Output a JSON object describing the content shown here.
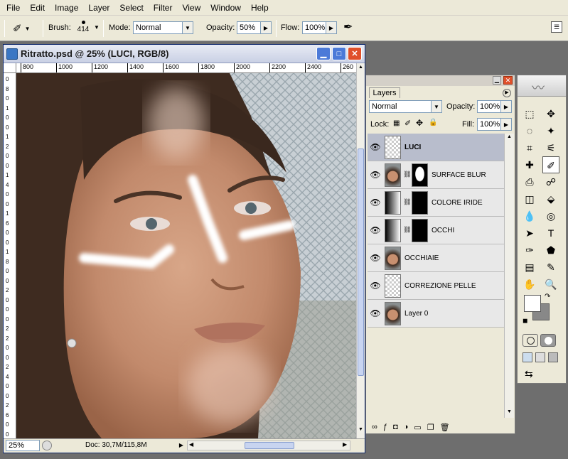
{
  "menu": [
    "File",
    "Edit",
    "Image",
    "Layer",
    "Select",
    "Filter",
    "View",
    "Window",
    "Help"
  ],
  "options": {
    "brush_label": "Brush:",
    "brush_size": "414",
    "mode_label": "Mode:",
    "mode_value": "Normal",
    "opacity_label": "Opacity:",
    "opacity_value": "50%",
    "flow_label": "Flow:",
    "flow_value": "100%"
  },
  "document": {
    "title": "Ritratto.psd @ 25% (LUCI, RGB/8)",
    "ruler_top": [
      "800",
      "1000",
      "1200",
      "1400",
      "1600",
      "1800",
      "2000",
      "2200",
      "2400",
      "260"
    ],
    "ruler_left": [
      "0",
      "8",
      "0",
      "1",
      "0",
      "0",
      "1",
      "2",
      "0",
      "0",
      "1",
      "4",
      "0",
      "0",
      "1",
      "6",
      "0",
      "0",
      "1",
      "8",
      "0",
      "0",
      "2",
      "0",
      "0",
      "0",
      "2",
      "2",
      "0",
      "0",
      "2",
      "4",
      "0",
      "0",
      "2",
      "6",
      "0",
      "0"
    ],
    "zoom": "25%",
    "doc_info": "Doc: 30,7M/115,8M"
  },
  "layers": {
    "tab": "Layers",
    "blend_mode": "Normal",
    "opacity_label": "Opacity:",
    "opacity_value": "100%",
    "lock_label": "Lock:",
    "fill_label": "Fill:",
    "fill_value": "100%",
    "items": [
      {
        "name": "LUCI",
        "selected": true,
        "thumb": "transparent",
        "mask": null
      },
      {
        "name": "SURFACE BLUR",
        "selected": false,
        "thumb": "photo",
        "mask": "silhouette"
      },
      {
        "name": "COLORE IRIDE",
        "selected": false,
        "thumb": "levels",
        "mask": "black"
      },
      {
        "name": "OCCHI",
        "selected": false,
        "thumb": "levels",
        "mask": "black"
      },
      {
        "name": "OCCHIAIE",
        "selected": false,
        "thumb": "photo",
        "mask": null
      },
      {
        "name": "CORREZIONE PELLE",
        "selected": false,
        "thumb": "transparent",
        "mask": null
      },
      {
        "name": "Layer 0",
        "selected": false,
        "thumb": "photo",
        "mask": null
      }
    ]
  },
  "tools": {
    "glyphs": [
      "⬚",
      "✥",
      "◌",
      "✦",
      "⌗",
      "✎",
      "✒",
      "⚘",
      "⬓",
      "◈",
      "💧",
      "◉",
      "➤",
      "T",
      "✑",
      "✪",
      "▤",
      "✐",
      "✋",
      "🔍"
    ],
    "tool_names": [
      "marquee-icon",
      "move-icon",
      "lasso-icon",
      "magic-wand-icon",
      "crop-icon",
      "eyedropper-icon",
      "healing-icon",
      "brush-icon",
      "stamp-icon",
      "history-brush-icon",
      "eraser-icon",
      "bucket-icon",
      "blur-icon",
      "dodge-icon",
      "path-select-icon",
      "type-icon",
      "pen-icon",
      "shape-icon",
      "notes-icon",
      "eyedropper2-icon",
      "hand-icon",
      "zoom-icon"
    ]
  },
  "colors": {
    "title_red": "#e0502a",
    "selected_layer": "#b8bdcc",
    "panel_bg": "#ece9d8"
  }
}
